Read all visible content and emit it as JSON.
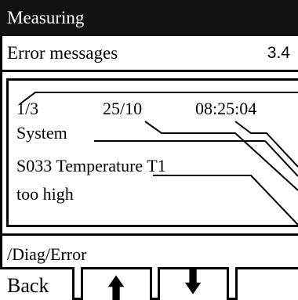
{
  "title": "Measuring",
  "header": {
    "label": "Error messages",
    "code": "3.4"
  },
  "message": {
    "index": "1/3",
    "date": "25/10",
    "time": "08:25:04",
    "line1": "System",
    "line2": "S033 Temperature T1",
    "line3": "too high"
  },
  "path": "/Diag/Error",
  "buttons": {
    "back": "Back",
    "up_icon": "arrow-up-icon",
    "down_icon": "arrow-down-icon"
  }
}
